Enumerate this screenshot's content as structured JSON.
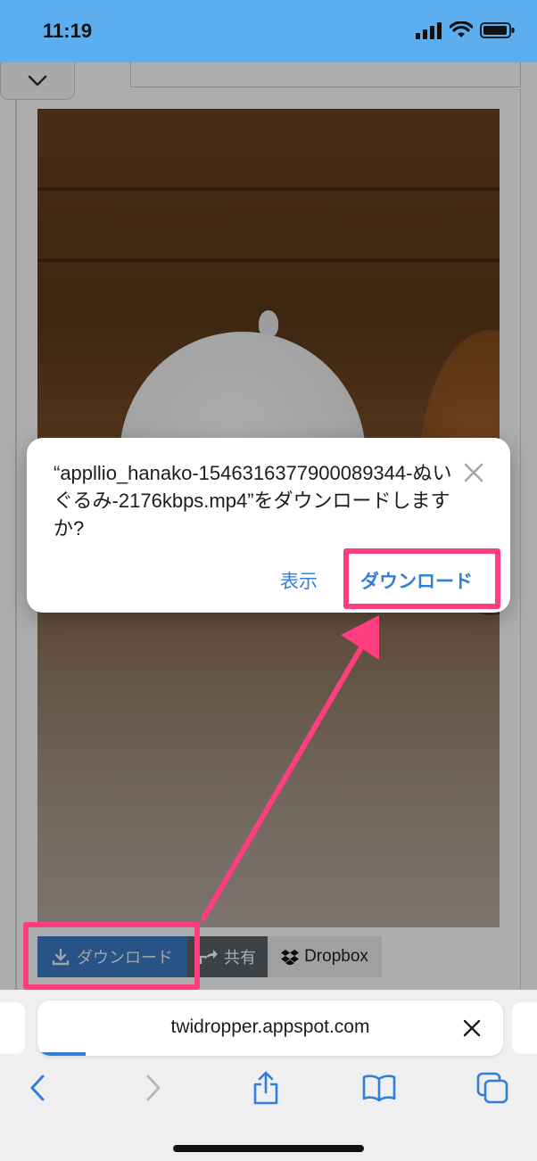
{
  "status_bar": {
    "time": "11:19"
  },
  "page": {
    "download_button": "ダウンロード",
    "share_button": "共有",
    "dropbox_button": "Dropbox"
  },
  "dialog": {
    "message": "“appllio_hanako-1546316377900089344-ぬいぐるみ-2176kbps.mp4”をダウンロードしますか?",
    "view_button": "表示",
    "download_button": "ダウンロード"
  },
  "safari": {
    "url": "twidropper.appspot.com"
  },
  "colors": {
    "status_bar": "#5daeee",
    "ios_blue": "#2f7fd8",
    "highlight": "#ff3d7f",
    "download_btn": "#3a7bc8"
  }
}
